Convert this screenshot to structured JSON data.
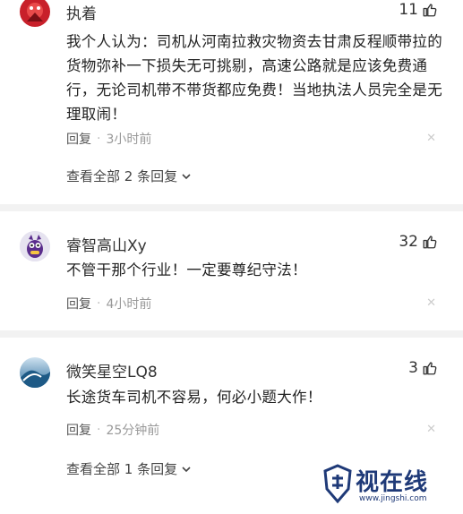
{
  "comments": [
    {
      "username": "执着",
      "likes": "11",
      "content": "我个人认为：司机从河南拉救灾物资去甘肃反程顺带拉的货物弥补一下损失无可挑剔，高速公路就是应该免费通行，无论司机带不带货都应免费！当地执法人员完全是无理取闹！",
      "reply_label": "回复",
      "time": "3小时前",
      "view_replies": "查看全部 2 条回复"
    },
    {
      "username": "睿智高山Xy",
      "likes": "32",
      "content": "不管干那个行业！一定要尊纪守法！",
      "reply_label": "回复",
      "time": "4小时前"
    },
    {
      "username": "微笑星空LQ8",
      "likes": "3",
      "content": "长途货车司机不容易，何必小题大作！",
      "reply_label": "回复",
      "time": "25分钟前",
      "view_replies": "查看全部 1 条回复"
    }
  ],
  "watermark": {
    "text": "视在线",
    "url": "www.jingshi.com"
  },
  "icons": {
    "like": "thumbs-up-icon",
    "close": "close-icon",
    "expand": "chevron-down-icon"
  },
  "colors": {
    "text": "#222222",
    "meta": "#999999",
    "watermark": "#1f3a78"
  }
}
